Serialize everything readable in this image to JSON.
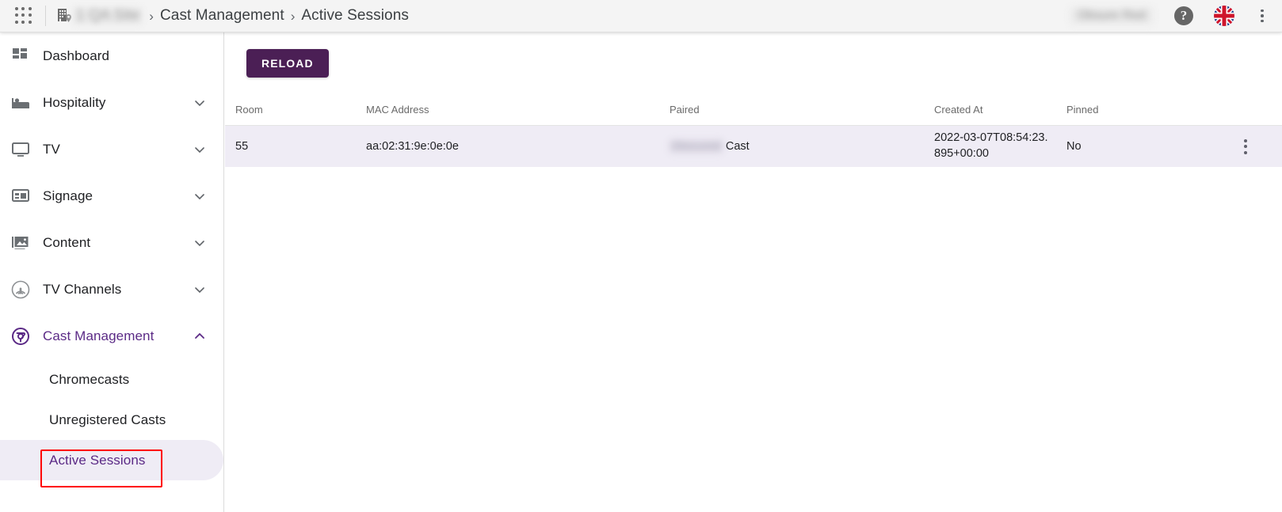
{
  "topbar": {
    "apps_icon": "apps-grid-icon",
    "breadcrumb": {
      "site_icon": "building-location-icon",
      "site_name": "1 QA Site",
      "separator": "›",
      "items": [
        {
          "label": "Cast Management"
        },
        {
          "label": "Active Sessions"
        }
      ]
    },
    "user_name": "Obsure Red",
    "help_label": "?",
    "flag_icon": "uk-flag-icon",
    "overflow_icon": "vertical-dots-icon"
  },
  "sidebar": {
    "items": [
      {
        "label": "Dashboard",
        "icon": "dashboard-icon",
        "expandable": false,
        "expanded": false
      },
      {
        "label": "Hospitality",
        "icon": "bed-icon",
        "expandable": true,
        "expanded": false
      },
      {
        "label": "TV",
        "icon": "television-icon",
        "expandable": true,
        "expanded": false
      },
      {
        "label": "Signage",
        "icon": "signage-icon",
        "expandable": true,
        "expanded": false
      },
      {
        "label": "Content",
        "icon": "image-icon",
        "expandable": true,
        "expanded": false
      },
      {
        "label": "TV Channels",
        "icon": "broadcast-icon",
        "expandable": true,
        "expanded": false
      },
      {
        "label": "Cast Management",
        "icon": "chromecast-icon",
        "expandable": true,
        "expanded": true
      }
    ],
    "subitems": [
      {
        "label": "Chromecasts",
        "selected": false
      },
      {
        "label": "Unregistered Casts",
        "selected": false
      },
      {
        "label": "Active Sessions",
        "selected": true
      }
    ]
  },
  "main": {
    "reload_label": "RELOAD",
    "table": {
      "columns": [
        "Room",
        "MAC Address",
        "Paired",
        "Created At",
        "Pinned"
      ],
      "rows": [
        {
          "room": "55",
          "mac_address": "aa:02:31:9e:0e:0e",
          "paired_blurred": "Obscured",
          "paired_suffix": "Cast",
          "created_at": "2022-03-07T08:54:23.895+00:00",
          "pinned": "No",
          "row_menu_icon": "vertical-dots-icon"
        }
      ]
    }
  },
  "annotation": {
    "highlight_color": "#ff0000",
    "target": "Active Sessions"
  },
  "colors": {
    "accent_purple": "#4b1f55",
    "active_row_bg": "#efecf5",
    "topbar_bg": "#f4f4f4",
    "link_purple": "#5b2a86"
  }
}
